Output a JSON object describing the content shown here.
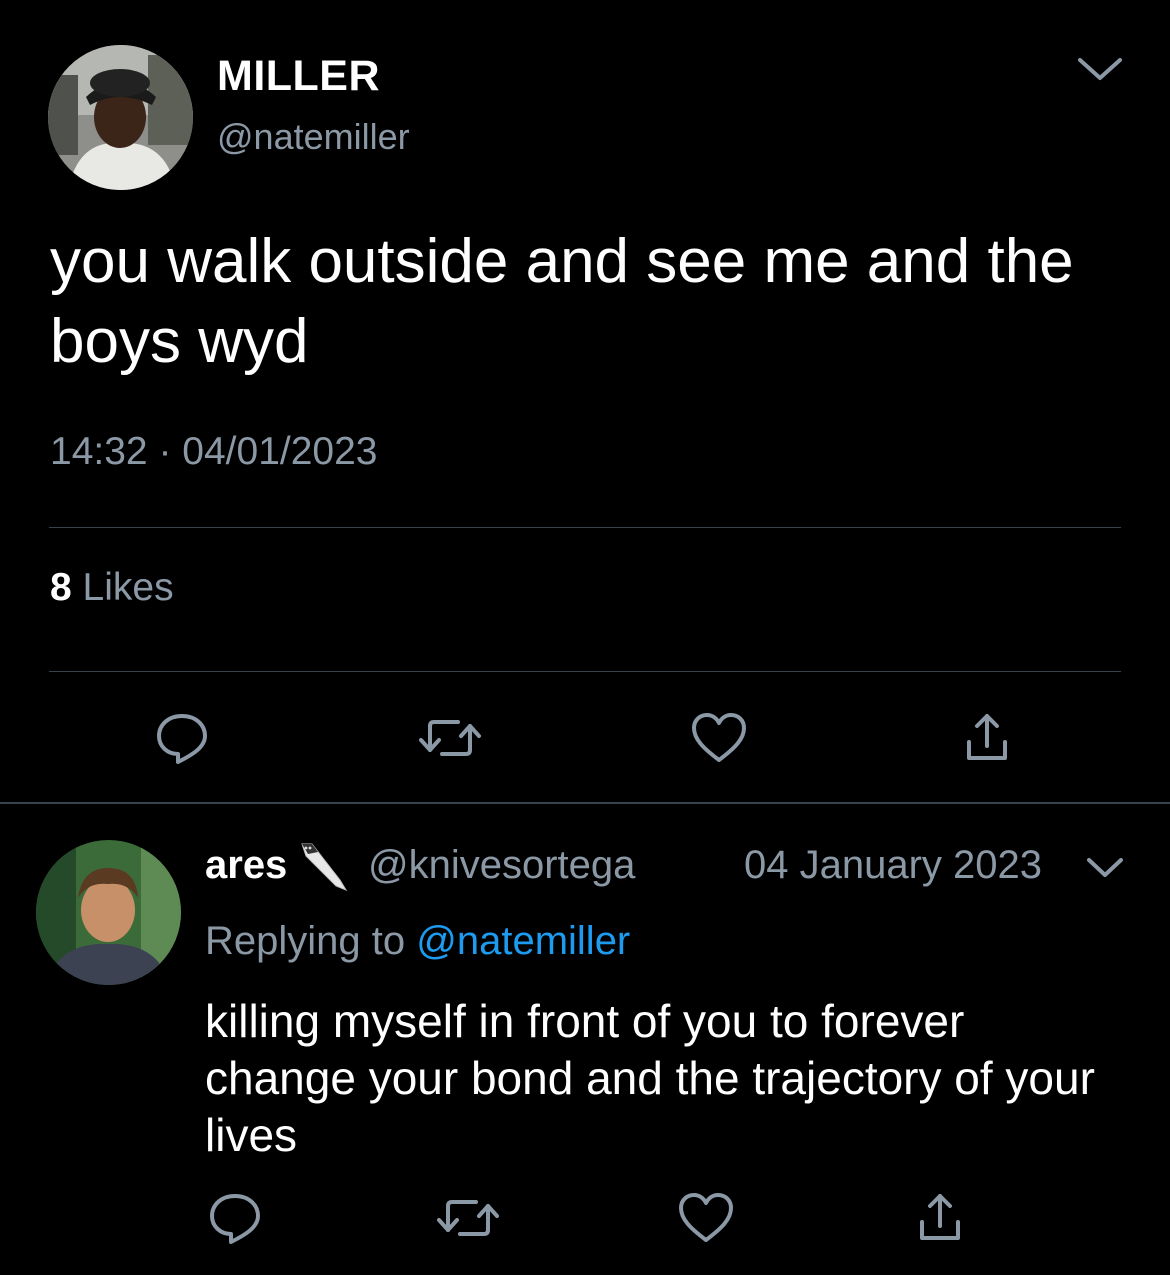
{
  "main_tweet": {
    "author_name": "MILLER",
    "author_handle": "@natemiller",
    "text": "you walk outside and see me and the boys wyd",
    "time": "14:32",
    "separator": "·",
    "date": "04/01/2023",
    "likes_count": "8",
    "likes_label": "Likes",
    "icons": {
      "avatar": "avatar-photo",
      "menu": "chevron-down-icon",
      "reply": "reply-icon",
      "retweet": "retweet-icon",
      "like": "heart-icon",
      "share": "share-icon"
    }
  },
  "reply_tweet": {
    "author_name": "ares",
    "author_emoji": "knife-icon",
    "author_handle": "@knivesortega",
    "date": "04 January 2023",
    "replying_prefix": "Replying to",
    "replying_to": "@natemiller",
    "text": "killing myself in front of you to forever change your bond and the trajectory of your lives",
    "icons": {
      "avatar": "avatar-photo",
      "menu": "chevron-down-icon",
      "reply": "reply-icon",
      "retweet": "retweet-icon",
      "like": "heart-icon",
      "share": "share-icon"
    }
  },
  "colors": {
    "background": "#000000",
    "text_primary": "#ffffff",
    "text_secondary": "#8b98a5",
    "link": "#1d9bf0",
    "divider": "#38444d"
  }
}
